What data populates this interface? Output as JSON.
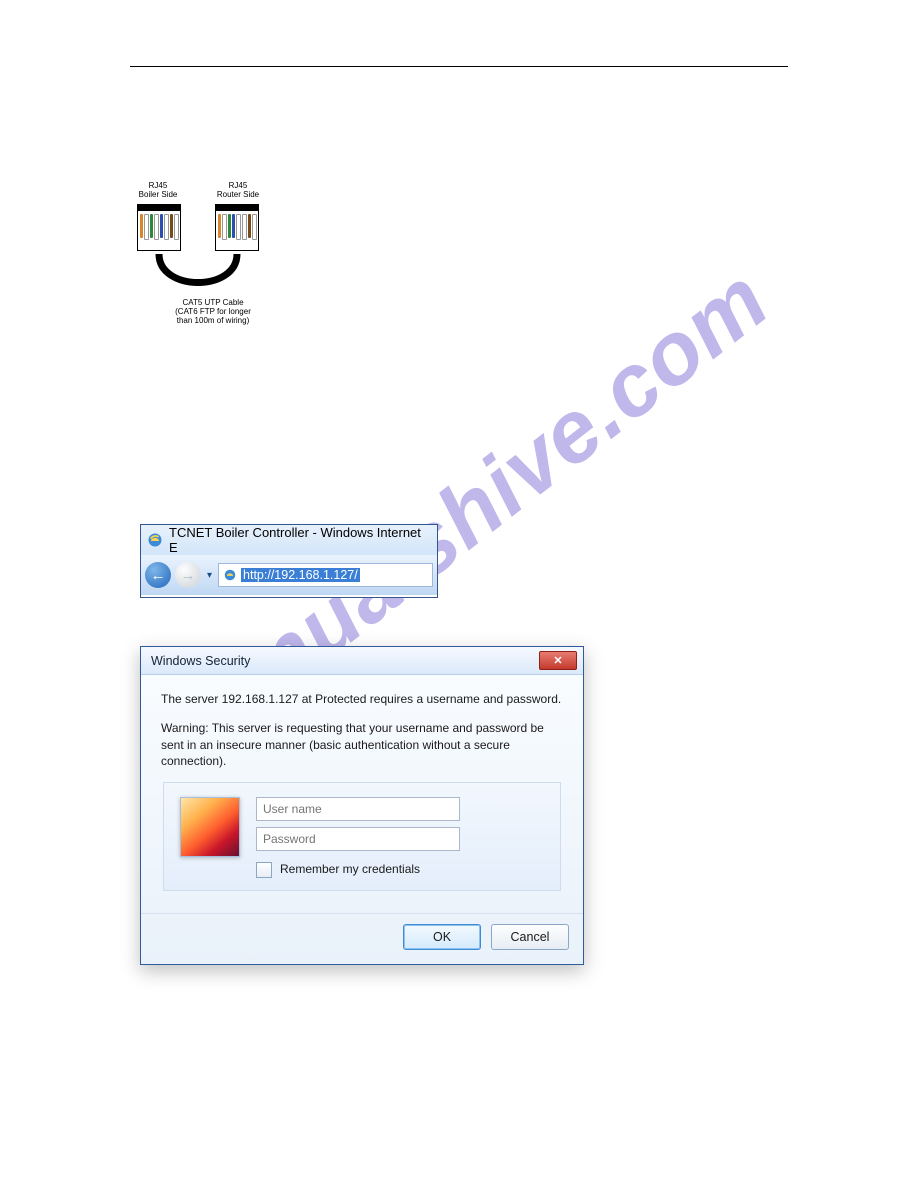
{
  "watermark": "manualshive.com",
  "diagram": {
    "left_label": "RJ45\nBoiler Side",
    "right_label": "RJ45\nRouter Side",
    "cable_label": "CAT5 UTP Cable\n(CAT6 FTP for longer\nthan 100m of wiring)",
    "left_pins": [
      "#d8862b",
      "#ffffff",
      "#2b8a3a",
      "#ffffff",
      "#2a4fb0",
      "#ffffff",
      "#7a4a1a",
      "#ffffff"
    ],
    "right_pins": [
      "#d8862b",
      "#ffffff",
      "#2b8a3a",
      "#2a4fb0",
      "#ffffff",
      "#ffffff",
      "#7a4a1a",
      "#ffffff"
    ]
  },
  "ie": {
    "title": "TCNET Boiler Controller - Windows Internet E",
    "url": "http://192.168.1.127/"
  },
  "dialog": {
    "title": "Windows Security",
    "line1": "The server 192.168.1.127 at Protected requires a username and password.",
    "warning": "Warning: This server is requesting that your username and password be sent in an insecure manner (basic authentication without a secure connection).",
    "user_placeholder": "User name",
    "pass_placeholder": "Password",
    "remember": "Remember my credentials",
    "ok": "OK",
    "cancel": "Cancel",
    "close": "✕"
  }
}
